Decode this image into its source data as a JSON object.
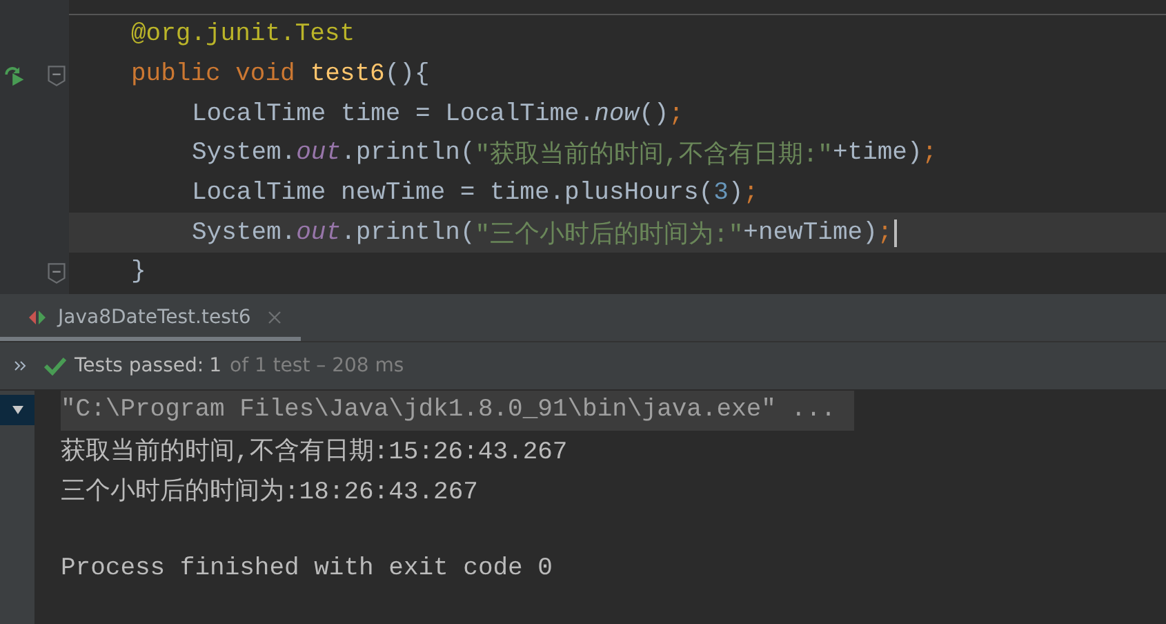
{
  "editor": {
    "lines": [
      {
        "run_marker": false,
        "fold": false,
        "current": false,
        "cursor": false,
        "tokens": [
          {
            "text": "@org.junit.",
            "kind": "annotation"
          },
          {
            "text": "Test",
            "kind": "annotation_name"
          }
        ]
      },
      {
        "run_marker": true,
        "fold": true,
        "current": false,
        "cursor": false,
        "tokens": [
          {
            "text": "public void",
            "kind": "keyword"
          },
          {
            "text": "test6",
            "kind": "method"
          },
          {
            "text": "(){",
            "kind": "plain"
          }
        ],
        "children": [
          {
            "run_marker": false,
            "fold": false,
            "current": false,
            "cursor": false,
            "tokens": [
              {
                "text": "LocalTime time = LocalTime.",
                "kind": "plain"
              },
              {
                "text": "now",
                "kind": "static"
              },
              {
                "text": "()",
                "kind": "plain"
              },
              {
                "text": ";",
                "kind": "semicolon"
              }
            ]
          },
          {
            "run_marker": false,
            "fold": false,
            "current": false,
            "cursor": false,
            "tokens": [
              {
                "text": "System.",
                "kind": "plain"
              },
              {
                "text": "out",
                "kind": "field"
              },
              {
                "text": ".println(",
                "kind": "plain"
              },
              {
                "text": "\"获取当前的时间,不含有日期:\"",
                "kind": "string"
              },
              {
                "text": "+time)",
                "kind": "plain"
              },
              {
                "text": ";",
                "kind": "semicolon"
              }
            ]
          },
          {
            "run_marker": false,
            "fold": false,
            "current": false,
            "cursor": false,
            "tokens": [
              {
                "text": "LocalTime newTime = time.plusHours(",
                "kind": "plain"
              },
              {
                "text": "3",
                "kind": "number"
              },
              {
                "text": ")",
                "kind": "plain"
              },
              {
                "text": ";",
                "kind": "semicolon"
              }
            ]
          },
          {
            "run_marker": false,
            "fold": false,
            "current": true,
            "cursor": true,
            "tokens": [
              {
                "text": "System.",
                "kind": "plain"
              },
              {
                "text": "out",
                "kind": "field"
              },
              {
                "text": ".println(",
                "kind": "plain"
              },
              {
                "text": "\"三个小时后的时间为:\"",
                "kind": "string"
              },
              {
                "text": "+newTime)",
                "kind": "plain"
              },
              {
                "text": ";",
                "kind": "semicolon"
              }
            ]
          }
        ]
      },
      {
        "run_marker": false,
        "fold": true,
        "current": false,
        "cursor": false,
        "tokens": [
          {
            "text": "}",
            "kind": "plain"
          }
        ]
      }
    ]
  },
  "run_tabs": [
    {
      "label": "Java8DateTest.test6",
      "selected": true
    }
  ],
  "status": {
    "label": "Tests passed:",
    "count": "1",
    "detail": "of 1 test – 208 ms"
  },
  "console": {
    "lines": [
      {
        "text": "\"C:\\Program Files\\Java\\jdk1.8.0_91\\bin\\java.exe\" ...",
        "highlighted": true
      },
      {
        "text": "获取当前的时间,不含有日期:15:26:43.267",
        "highlighted": false
      },
      {
        "text": "三个小时后的时间为:18:26:43.267",
        "highlighted": false
      },
      {
        "highlighted": false
      },
      {
        "text": "Process finished with exit code 0",
        "highlighted": false
      }
    ]
  }
}
